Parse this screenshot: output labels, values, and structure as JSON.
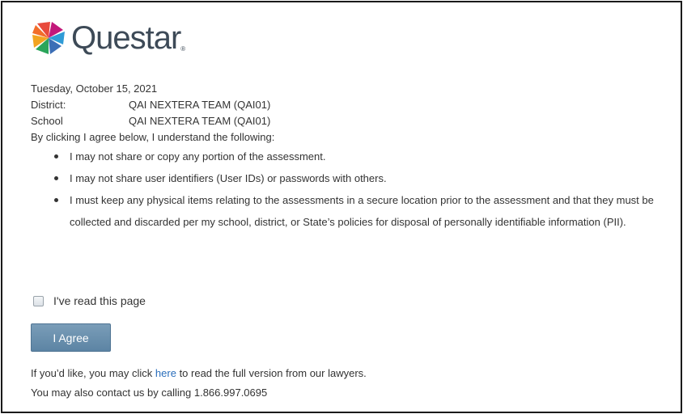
{
  "brand": {
    "name": "Questar",
    "trademark": "®",
    "logo_icon": "pinwheel-logo-icon"
  },
  "date": "Tuesday, October 15, 2021",
  "district": {
    "label": "District:",
    "value": "QAI NEXTERA TEAM (QAI01)"
  },
  "school": {
    "label": "School",
    "value": "QAI NEXTERA TEAM (QAI01)"
  },
  "intro": "By clicking I agree below, I understand the following:",
  "terms": [
    "I may not share or copy any portion of the assessment.",
    "I may not share user identifiers (User IDs) or passwords with others.",
    "I must keep any physical items relating to the assessments in a secure location prior to the assessment and that they must be collected and discarded per my school, district, or State’s policies for disposal of personally identifiable information (PII)."
  ],
  "checkbox": {
    "label": "I've read this page",
    "checked": false
  },
  "agree_button": {
    "label": "I Agree"
  },
  "footer": {
    "line1_before": "If you’d like, you may click",
    "link": "here",
    "line1_after": "to read the full version from our lawyers.",
    "line2": "You may also contact us by calling 1.866.997.0695"
  },
  "colors": {
    "button": "#6a91b0",
    "link": "#2a6ebb",
    "text": "#333333",
    "logo_text": "#3d4a57"
  }
}
